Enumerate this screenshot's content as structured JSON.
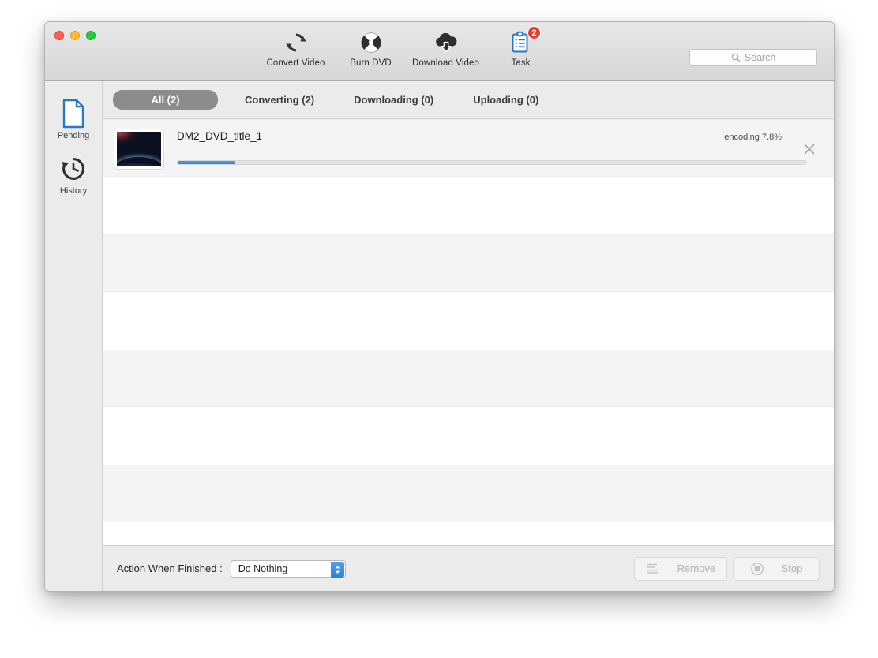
{
  "window": {
    "traffic_lights": [
      {
        "name": "close",
        "color": "#ff5f57"
      },
      {
        "name": "minimize",
        "color": "#ffbd2e"
      },
      {
        "name": "zoom",
        "color": "#28c840"
      }
    ]
  },
  "toolbar": {
    "items": [
      {
        "label": "Convert Video",
        "icon": "convert-video-icon",
        "badge": null
      },
      {
        "label": "Burn DVD",
        "icon": "burn-dvd-icon",
        "badge": null
      },
      {
        "label": "Download Video",
        "icon": "download-video-icon",
        "badge": null
      },
      {
        "label": "Task",
        "icon": "task-icon",
        "badge": "2"
      }
    ]
  },
  "search": {
    "placeholder": "Search",
    "value": "",
    "icon": "search-icon"
  },
  "sidebar": {
    "items": [
      {
        "label": "Pending",
        "icon": "document-icon",
        "selected": true
      },
      {
        "label": "History",
        "icon": "history-clock-icon",
        "selected": false
      }
    ]
  },
  "tabs": [
    {
      "label": "All (2)",
      "active": true
    },
    {
      "label": "Converting (2)",
      "active": false
    },
    {
      "label": "Downloading (0)",
      "active": false
    },
    {
      "label": "Uploading (0)",
      "active": false
    }
  ],
  "task_list": {
    "tasks": [
      {
        "title": "DM2_DVD_title_1",
        "status": "encoding 7.8%",
        "progress_percent": 7.8,
        "progress_bar_fill_percent": 9,
        "thumbnail": "earth-from-space-thumbnail",
        "close_icon": "close-x-icon"
      }
    ],
    "empty_row_count": 7
  },
  "footer": {
    "action_label": "Action When Finished :",
    "action_select": {
      "value": "Do Nothing",
      "options": [
        "Do Nothing"
      ],
      "stepper_icon": "stepper-up-down-icon",
      "accent_color": "#2f7fdd"
    },
    "buttons": [
      {
        "label": "Remove",
        "icon": "remove-list-icon",
        "enabled": false
      },
      {
        "label": "Stop",
        "icon": "stop-circle-icon",
        "enabled": false
      }
    ]
  },
  "colors": {
    "accent_blue": "#2f86e0",
    "badge_red": "#ec3b2e",
    "tab_active_bg": "#8c8c8c",
    "sidebar_bg": "#ebebeb"
  }
}
